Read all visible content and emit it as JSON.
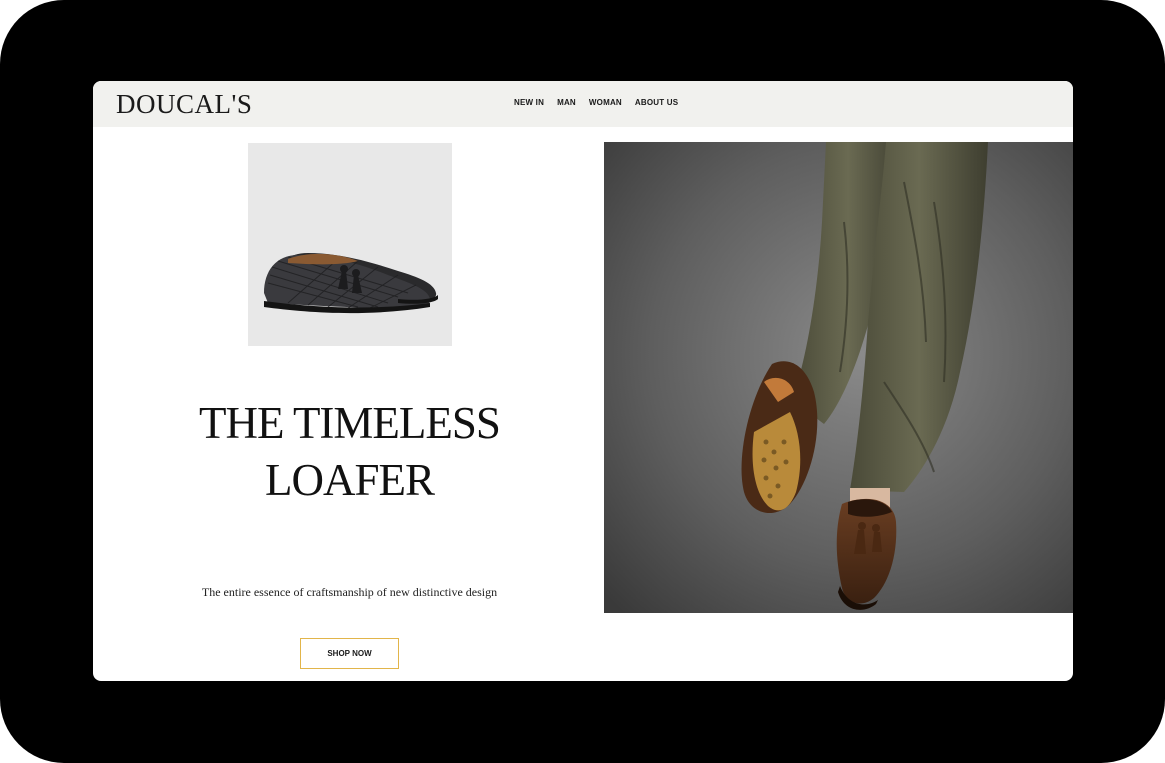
{
  "brand": {
    "logo": "DOUCAL'S"
  },
  "nav": {
    "items": [
      {
        "label": "NEW IN"
      },
      {
        "label": "MAN"
      },
      {
        "label": "WOMAN"
      },
      {
        "label": "ABOUT US"
      }
    ]
  },
  "hero": {
    "title_line_1": "THE TIMELESS",
    "title_line_2": "LOAFER",
    "tagline": "The entire essence of craftsmanship of new distinctive design",
    "cta_label": "SHOP NOW"
  },
  "images": {
    "product_thumbnail": "black-woven-tassel-loafers",
    "hero_photo": "legs-in-olive-trousers-brown-tassel-loafers"
  },
  "colors": {
    "nav_background": "#f1f1ee",
    "cta_border": "#e2b54a",
    "text": "#111111"
  }
}
